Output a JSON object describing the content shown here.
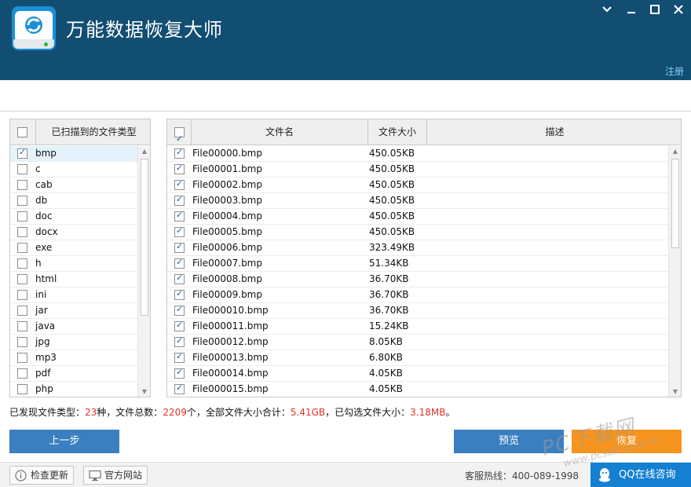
{
  "app": {
    "title": "万能数据恢复大师",
    "register_label": "注册",
    "window_controls": [
      "chevron-down-icon",
      "minimize-icon",
      "maximize-icon",
      "close-icon"
    ]
  },
  "left_panel": {
    "header_label": "已扫描到的文件类型",
    "header_checked": false,
    "items": [
      {
        "label": "bmp",
        "checked": true,
        "selected": true
      },
      {
        "label": "c",
        "checked": false
      },
      {
        "label": "cab",
        "checked": false
      },
      {
        "label": "db",
        "checked": false
      },
      {
        "label": "doc",
        "checked": false
      },
      {
        "label": "docx",
        "checked": false
      },
      {
        "label": "exe",
        "checked": false
      },
      {
        "label": "h",
        "checked": false
      },
      {
        "label": "html",
        "checked": false
      },
      {
        "label": "ini",
        "checked": false
      },
      {
        "label": "jar",
        "checked": false
      },
      {
        "label": "java",
        "checked": false
      },
      {
        "label": "jpg",
        "checked": false
      },
      {
        "label": "mp3",
        "checked": false
      },
      {
        "label": "pdf",
        "checked": false
      },
      {
        "label": "php",
        "checked": false
      }
    ]
  },
  "file_table": {
    "header_checked": true,
    "columns": {
      "name": "文件名",
      "size": "文件大小",
      "desc": "描述"
    },
    "rows": [
      {
        "name": "File00000.bmp",
        "size": "450.05KB",
        "desc": "",
        "checked": true
      },
      {
        "name": "File00001.bmp",
        "size": "450.05KB",
        "desc": "",
        "checked": true
      },
      {
        "name": "File00002.bmp",
        "size": "450.05KB",
        "desc": "",
        "checked": true
      },
      {
        "name": "File00003.bmp",
        "size": "450.05KB",
        "desc": "",
        "checked": true
      },
      {
        "name": "File00004.bmp",
        "size": "450.05KB",
        "desc": "",
        "checked": true
      },
      {
        "name": "File00005.bmp",
        "size": "450.05KB",
        "desc": "",
        "checked": true
      },
      {
        "name": "File00006.bmp",
        "size": "323.49KB",
        "desc": "",
        "checked": true
      },
      {
        "name": "File00007.bmp",
        "size": "51.34KB",
        "desc": "",
        "checked": true
      },
      {
        "name": "File00008.bmp",
        "size": "36.70KB",
        "desc": "",
        "checked": true
      },
      {
        "name": "File00009.bmp",
        "size": "36.70KB",
        "desc": "",
        "checked": true
      },
      {
        "name": "File000010.bmp",
        "size": "36.70KB",
        "desc": "",
        "checked": true
      },
      {
        "name": "File000011.bmp",
        "size": "15.24KB",
        "desc": "",
        "checked": true
      },
      {
        "name": "File000012.bmp",
        "size": "8.05KB",
        "desc": "",
        "checked": true
      },
      {
        "name": "File000013.bmp",
        "size": "6.80KB",
        "desc": "",
        "checked": true
      },
      {
        "name": "File000014.bmp",
        "size": "4.05KB",
        "desc": "",
        "checked": true
      },
      {
        "name": "File000015.bmp",
        "size": "4.05KB",
        "desc": "",
        "checked": true
      }
    ]
  },
  "summary": {
    "types_label": "已发现文件类型：",
    "types_count": "23",
    "types_unit": "种，文件总数：",
    "files_count": "2209",
    "files_unit": "个，全部文件大小合计：",
    "total_size": "5.41GB",
    "checked_label": "，已勾选文件大小：",
    "checked_size": "3.18MB",
    "end": "。"
  },
  "actions": {
    "back_label": "上一步",
    "preview_label": "预览",
    "recover_label": "恢复"
  },
  "footer": {
    "check_update_label": "检查更新",
    "website_label": "官方网站",
    "hotline": "客服热线：400-089-1998",
    "qq_label": "QQ在线咨询"
  },
  "watermark": {
    "brand": "PC下载网",
    "url": "www.pcsoft.com.cn"
  },
  "colors": {
    "titlebar": "#124e72",
    "accent_blue": "#3a7fc0",
    "accent_orange": "#f7941d",
    "highlight_red": "#e0322a",
    "qq_blue": "#1580d2"
  }
}
